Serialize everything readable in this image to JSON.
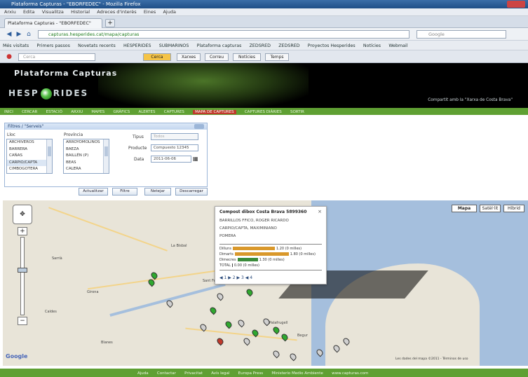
{
  "browser": {
    "window_title": "Plataforma Capturas - \"EBORFEDEC\" - Mozilla Firefox",
    "menu": [
      "Arxiu",
      "Edita",
      "Visualitza",
      "Historial",
      "Adreces d'interès",
      "Eines",
      "Ajuda"
    ],
    "tab_label": "Plataforma Capturas - \"EBORFEDEC\"",
    "new_tab_symbol": "+",
    "url": "capturas.hesperides.cat/mapa/capturas",
    "search_placeholder": "Google",
    "bookmarks": [
      "Més visitats",
      "Primers passos",
      "Novetats recents",
      "HESPERIDES",
      "SUBMARINOS",
      "Plataforma capturas",
      "ZEDSRED",
      "ZEDSRED",
      "Proyectos Hesperides",
      "Notícies",
      "Webmail"
    ],
    "toolbar_search_placeholder": "Cerca",
    "toolbar_buttons": [
      "Cerca",
      "Xarxes",
      "Correu",
      "Notícies",
      "Temps"
    ]
  },
  "site": {
    "title": "Plataforma Capturas",
    "logo_text_left": "HESP",
    "logo_text_right": "RIDES",
    "header_right": "Compartit amb la \"Xarxa de Costa Brava\"",
    "nav": [
      "INICI",
      "CERCAR",
      "ESTACIÓ",
      "ARXIU",
      "MAPES",
      "GRÀFICS",
      "ALERTES",
      "CAPTURES",
      "MAPA DE CAPTURES",
      "CAPTURES DIÀRIES",
      "SORTIR"
    ],
    "nav_active_index": 8
  },
  "filter": {
    "title": "Filtres / \"Serveis\"",
    "labels": {
      "place": "Lloc",
      "province": "Província",
      "type": "Tipus",
      "product": "Producte",
      "date": "Data"
    },
    "places": [
      "ARCHIVEROS",
      "BARRERA",
      "CAÑAS",
      "CARPIO/CAPTA",
      "CIMBOGOTERA"
    ],
    "places_selected_index": 3,
    "provinces": [
      "ARROYOMOLINOS",
      "BAEZA",
      "BAILLÉN (P)",
      "BEAS",
      "CALERA"
    ],
    "type_value": "Todos",
    "product_value": "Compuesto 12345",
    "date_value": "2011-06-06",
    "buttons": [
      "Actualitzar",
      "Filtre",
      "Netejar",
      "Descarregar"
    ]
  },
  "map": {
    "type_buttons": [
      "Mapa",
      "Satèl·lit",
      "Híbrid"
    ],
    "active_type_index": 0,
    "places": [
      "La Bisbal",
      "Girona",
      "Sarrià",
      "Caldes",
      "Sant Feliu",
      "Palafrugell",
      "Begur",
      "Blanes"
    ],
    "copyright": "Les dades del mapa ©2011 - Términos de uso",
    "google_logo": "Google"
  },
  "info_window": {
    "title": "Compost dibox Costa Brava 5899360",
    "lines": [
      "BARRILLOS FFICO, ROGER RICARDO",
      "CARPIO/CAPTA, MAXIMINIANO",
      "POMERA"
    ],
    "bars": [
      {
        "label": "Dilluns",
        "value": "1.20 (0 milles)",
        "color": "#d9982b",
        "fraction": 0.62
      },
      {
        "label": "Dimarts",
        "value": "1.80 (0 milles)",
        "color": "#d9982b",
        "fraction": 0.8
      },
      {
        "label": "Dimecres",
        "value": "1.30 (0 milles)",
        "color": "#3a8a3a",
        "fraction": 0.3
      },
      {
        "label": "TOTAL",
        "value": "0.00 (0 milles)",
        "color": "#444444",
        "fraction": 0.0
      }
    ],
    "close_symbol": "×",
    "icons_text": "◀ 1 ▶ 2 ▶ 3 ◀ 4"
  },
  "footer": {
    "links": [
      "Ajuda",
      "Contactar",
      "Privacitat",
      "Avís legal",
      "Europa Press",
      "Ministerio Medio Ambiente",
      "www.capturas.com"
    ]
  }
}
